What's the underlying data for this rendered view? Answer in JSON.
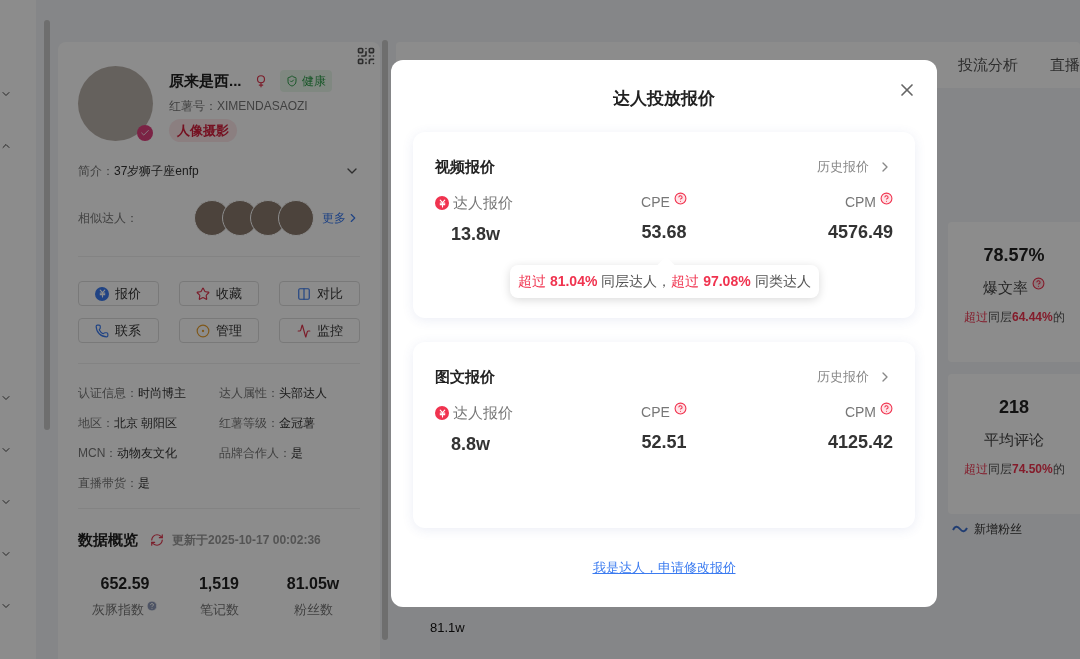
{
  "nav_groups": [
    {
      "expanded": false
    },
    {
      "expanded": true
    },
    {
      "expanded": false
    },
    {
      "expanded": false
    },
    {
      "expanded": false
    },
    {
      "expanded": false
    },
    {
      "expanded": false
    }
  ],
  "profile": {
    "name": "原来是西...",
    "health": "健康",
    "id_text": "红薯号：XIMENDASAOZI",
    "tag": "人像摄影",
    "intro_label": "简介：",
    "intro": "37岁狮子座enfp",
    "similar_label": "相似达人：",
    "more": "更多",
    "actions": [
      {
        "label": "报价",
        "kind": "quote"
      },
      {
        "label": "收藏",
        "kind": "favorite"
      },
      {
        "label": "对比",
        "kind": "compare"
      },
      {
        "label": "联系",
        "kind": "contact"
      },
      {
        "label": "管理",
        "kind": "manage"
      },
      {
        "label": "监控",
        "kind": "monitor"
      }
    ],
    "info": [
      {
        "label": "认证信息：",
        "value": "时尚博主"
      },
      {
        "label": "达人属性：",
        "value": "头部达人"
      },
      {
        "label": "地区：",
        "value": "北京 朝阳区"
      },
      {
        "label": "红薯等级：",
        "value": "金冠薯"
      },
      {
        "label": "MCN：",
        "value": "动物友文化"
      },
      {
        "label": "品牌合作人：",
        "value": "是"
      },
      {
        "label": "直播带货：",
        "value": "是"
      }
    ],
    "overview_title": "数据概览",
    "updated": "更新于2025-10-17 00:02:36",
    "stats": [
      {
        "value": "652.59",
        "label": "灰豚指数",
        "help": true
      },
      {
        "value": "1,519",
        "label": "笔记数",
        "help": false
      },
      {
        "value": "81.05w",
        "label": "粉丝数",
        "help": false
      }
    ]
  },
  "tabs": [
    {
      "label": "投流分析",
      "selected": false
    },
    {
      "label": "直播",
      "selected": false
    }
  ],
  "stat_cards": [
    {
      "value": "78.57%",
      "label": "爆文率",
      "help": true,
      "note": [
        {
          "text": "超过",
          "kind": "red"
        },
        {
          "text": "同层",
          "kind": "plain"
        },
        {
          "text": "64.44%",
          "kind": "bold"
        },
        {
          "text": "的",
          "kind": "plain"
        }
      ]
    },
    {
      "value": "218",
      "label": "平均评论",
      "help": false,
      "note": [
        {
          "text": "超过",
          "kind": "red"
        },
        {
          "text": "同层",
          "kind": "plain"
        },
        {
          "text": "74.50%",
          "kind": "bold"
        },
        {
          "text": "的",
          "kind": "plain"
        }
      ]
    }
  ],
  "legend": "新增粉丝",
  "axis_label": "81.1w",
  "modal": {
    "title": "达人投放报价",
    "link": "我是达人，申请修改报价",
    "sections": [
      {
        "title": "视频报价",
        "history": "历史报价",
        "price_label": "达人报价",
        "price": "13.8w",
        "cpe_label": "CPE",
        "cpe": "53.68",
        "cpm_label": "CPM",
        "cpm": "4576.49",
        "tooltip": [
          {
            "text": "超过 ",
            "kind": "red"
          },
          {
            "text": "81.04%",
            "kind": "bold"
          },
          {
            "text": " 同层达人，",
            "kind": "plain"
          },
          {
            "text": "超过 ",
            "kind": "red"
          },
          {
            "text": "97.08%",
            "kind": "bold"
          },
          {
            "text": " 同类达人",
            "kind": "plain"
          }
        ]
      },
      {
        "title": "图文报价",
        "history": "历史报价",
        "price_label": "达人报价",
        "price": "8.8w",
        "cpe_label": "CPE",
        "cpe": "52.51",
        "cpm_label": "CPM",
        "cpm": "4125.42"
      }
    ]
  }
}
